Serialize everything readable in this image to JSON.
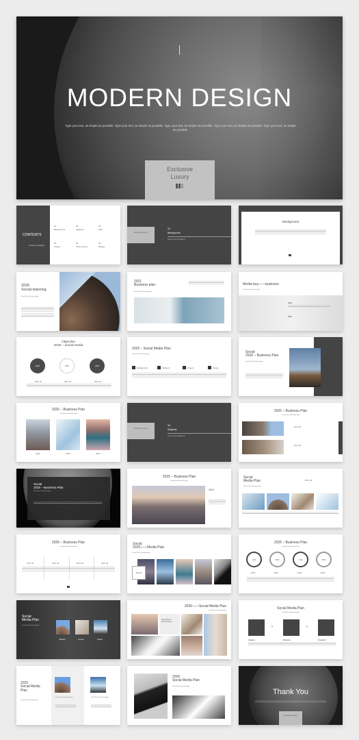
{
  "hero": {
    "title": "MODERN DESIGN",
    "subtitle": "Type your text, as simple as possible. Type your text, as simple as possible. Type your text, as simple as possible. Type your text, as simple as possible. Type your text, as simple as possible.",
    "badge_line1": "Exclusive",
    "badge_line2": "Luxury"
  },
  "contents": {
    "title": "CONTENTS",
    "subtitle": "Contents & category",
    "items": [
      {
        "num": "01.",
        "label": "Background"
      },
      {
        "num": "02.",
        "label": "Subjects"
      },
      {
        "num": "03.",
        "label": "Plan"
      },
      {
        "num": "04.",
        "label": "Project"
      },
      {
        "num": "05.",
        "label": "Performance"
      },
      {
        "num": "06.",
        "label": "Budget"
      }
    ]
  },
  "section1": {
    "badge": "Exclusive Luxury",
    "num": "01.",
    "title": "Background",
    "caption": "BACKGROUND RESEARCH"
  },
  "background": {
    "title": "Background"
  },
  "social_listening": {
    "year": "2025",
    "title": "Social listening",
    "sub": "Social Plan & Benchmarking"
  },
  "business_plan_2021": {
    "year": "2021",
    "title": "Business plan",
    "sub": "Social Plan & Benchmarking"
  },
  "media_buy": {
    "title": "Media buy——business",
    "sub": "Social Plan & Benchmarking",
    "items": [
      "Start",
      "PDF"
    ]
  },
  "objective": {
    "title1": "Objective",
    "title2": "2025 – social media",
    "circles": [
      "2025",
      "2025",
      "2025"
    ],
    "values": [
      "30% off",
      "30% off",
      "30% off"
    ]
  },
  "smp_2025": {
    "title": "2025 – Social Media Plan",
    "sub": "Social Plan & Benchmarking",
    "items": [
      "Background",
      "Subjects",
      "Project",
      "Target"
    ]
  },
  "social_2026": {
    "title1": "Social",
    "title2": "2026 – Business Plan",
    "sub": "Social Plan & Benchmarking"
  },
  "bp_years": {
    "title": "2025 – Business Plan",
    "sub": "Social Plan & Benchmarking",
    "years": [
      "2020",
      "2026",
      "2027"
    ]
  },
  "section2": {
    "badge": "Exclusive Luxury",
    "num": "02.",
    "title": "Subjects",
    "caption": "BACKGROUND RESEARCH"
  },
  "bp_off": {
    "title": "2025 – Business Plan",
    "sub": "Social Plan & Benchmarking",
    "values": [
      "50% off",
      "50% off"
    ]
  },
  "social_dark": {
    "title1": "Social",
    "title2": "2025 – Business Plan",
    "sub": "Social Plan & Benchmarking"
  },
  "bp_city": {
    "title": "2025 – Business Plan",
    "sub": "Social Plan & Benchmarking",
    "year": "2019"
  },
  "smp_images": {
    "title1": "Social",
    "title2": "Media Plan",
    "sub": "Social Plan & Benchmarking",
    "value": "50% off"
  },
  "bp_cols": {
    "title": "2025 – Business Plan",
    "sub": "Social Plan & Benchmarking",
    "values": [
      "43% off",
      "60% off",
      "50% off",
      "43% off"
    ]
  },
  "social_media_2025": {
    "title1": "Social",
    "title2": "2025——Media Plan",
    "sub": "Social Plan & Benchmarking",
    "badge": "50% off"
  },
  "bp_rings": {
    "title": "2025 – Business Plan",
    "sub": "Social Plan & Benchmarking",
    "rings": [
      {
        "pct": "74%",
        "num": "4,387"
      },
      {
        "pct": "35%",
        "num": "4,387"
      },
      {
        "pct": "74%",
        "num": "4,387"
      },
      {
        "pct": "35%",
        "num": "4,387"
      }
    ]
  },
  "smp_dark": {
    "title1": "Social",
    "title2": "Media Plan",
    "sub": "Social Plan & Benchmarking",
    "items": [
      "Classic",
      "Luxury",
      "Clean"
    ]
  },
  "smp_collage": {
    "title": "2026——Social Media Plan",
    "sub": "Social Plan & Benchmarking",
    "card": "Social Plan & Benchmarking"
  },
  "smp_steps": {
    "title": "Social Media Plan",
    "sub": "Social Plan & Benchmarking",
    "items": [
      "Classic",
      "Minimal",
      "Powerful"
    ]
  },
  "smp_2025b": {
    "year": "2025",
    "title1": "Social Media",
    "title2": "Plan",
    "sub": "Social Plan & Benchmarking",
    "captions": [
      "Social Plan & Benchmarking",
      "Social Plan & Benchmarking"
    ]
  },
  "smp_2026": {
    "year": "2026",
    "title": "Social Media Plan",
    "sub": "Social Plan & Benchmarking"
  },
  "thanks": {
    "title": "Thank You",
    "badge": "Exclusive Luxury"
  },
  "colors": {
    "dark_panel": "#444444",
    "background": "#ececec",
    "badge": "#bdbdbd"
  }
}
